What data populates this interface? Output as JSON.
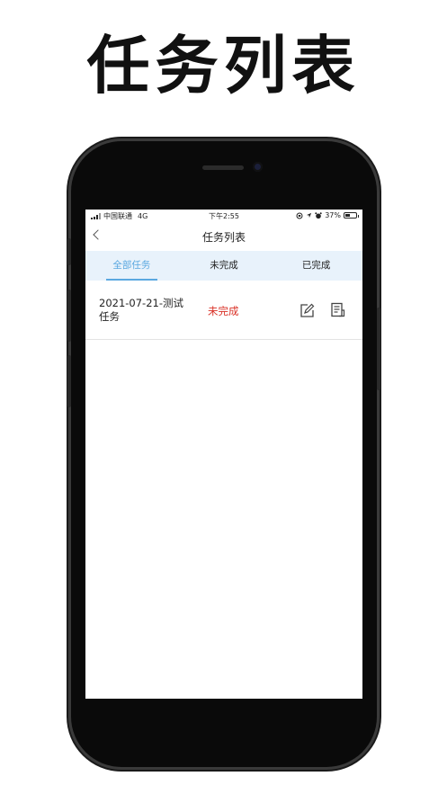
{
  "promo": {
    "title": "任务列表"
  },
  "status_bar": {
    "carrier": "中国联通",
    "network": "4G",
    "time": "下午2:55",
    "battery": "37%"
  },
  "nav": {
    "title": "任务列表"
  },
  "tabs": [
    {
      "label": "全部任务",
      "active": true
    },
    {
      "label": "未完成",
      "active": false
    },
    {
      "label": "已完成",
      "active": false
    }
  ],
  "tasks": [
    {
      "name": "2021-07-21-测试任务",
      "status": "未完成"
    }
  ],
  "colors": {
    "accent": "#5aa8e0",
    "tab_bg": "#e8f2fb",
    "status_incomplete": "#d93025"
  }
}
